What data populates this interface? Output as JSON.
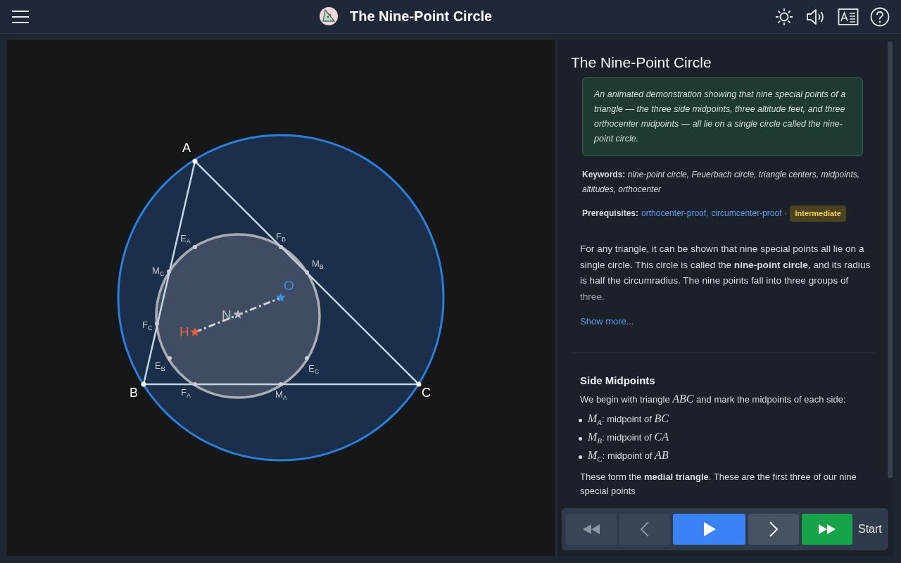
{
  "header": {
    "title": "The Nine-Point Circle"
  },
  "diagram": {
    "vertices": [
      {
        "label": "A"
      },
      {
        "label": "B"
      },
      {
        "label": "C"
      }
    ],
    "points": [
      {
        "label": "E$_{A}$"
      },
      {
        "label": "F$_{B}$"
      },
      {
        "label": "M$_{B}$"
      },
      {
        "label": "M$_{C}$"
      },
      {
        "label": "F$_{C}$"
      },
      {
        "label": "E$_{B}$"
      },
      {
        "label": "E$_{C}$"
      },
      {
        "label": "F$_{A}$"
      },
      {
        "label": "M$_{A}$"
      }
    ],
    "centers": [
      {
        "label": "H",
        "color": "#f0603c"
      },
      {
        "label": "N",
        "color": "#b8bcc4"
      },
      {
        "label": "O",
        "color": "#3a8fe8"
      }
    ]
  },
  "panel": {
    "title": "The Nine-Point Circle",
    "summary": "An animated demonstration showing that nine special points of a triangle — the three side midpoints, three altitude feet, and three orthocenter midpoints — all lie on a single circle called the nine-point circle.",
    "keywords_label": "Keywords:",
    "keywords": "nine-point circle, Feuerbach circle, triangle centers, midpoints, altitudes, orthocenter",
    "prerequisites_label": "Prerequisites:",
    "prerequisites": [
      "orthocenter-proof,",
      "circumcenter-proof"
    ],
    "separator": "·",
    "level_badge": "Intermediate",
    "intro": "For any triangle, it can be shown that nine special points all lie on a single circle. This circle is called the **nine-point circle**, and its radius is half the circumradius. The nine points fall into three groups of three.",
    "show_more": "Show more...",
    "section": {
      "heading": "Side Midpoints",
      "lead": "We begin with triangle *ABC* and mark the midpoints of each side:",
      "items": [
        "*M*$_{A}$: midpoint of *BC*",
        "*M*$_{B}$: midpoint of *CA*",
        "*M*$_{C}$: midpoint of *AB*"
      ],
      "closing": "These form the **medial triangle**. These are the first three of our nine special points"
    }
  },
  "controls": [
    {
      "kind": "rewind",
      "disabled": true
    },
    {
      "kind": "prev",
      "disabled": true
    },
    {
      "kind": "play",
      "disabled": false
    },
    {
      "kind": "next",
      "disabled": false
    },
    {
      "kind": "end",
      "disabled": false
    }
  ],
  "step_label": "Start"
}
